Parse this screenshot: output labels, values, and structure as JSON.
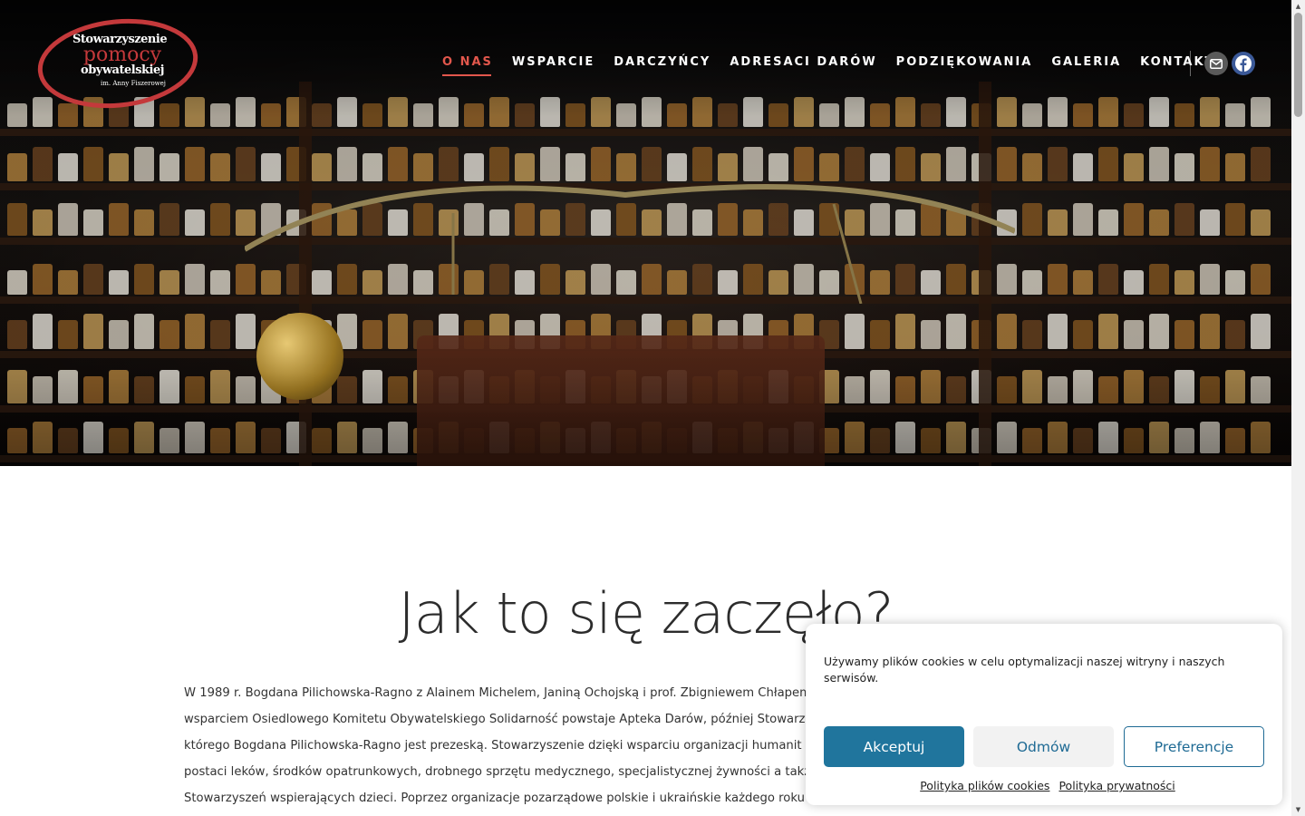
{
  "header": {
    "logo": {
      "line1": "Stowarzyszenie",
      "line2": "pomocy",
      "line3": "obywatelskiej",
      "line4": "im. Anny Fiszerowej"
    },
    "nav": [
      {
        "label": "O NAS",
        "active": true
      },
      {
        "label": "WSPARCIE",
        "active": false
      },
      {
        "label": "DARCZYŃCY",
        "active": false
      },
      {
        "label": "ADRESACI DARÓW",
        "active": false
      },
      {
        "label": "PODZIĘKOWANIA",
        "active": false
      },
      {
        "label": "GALERIA",
        "active": false
      },
      {
        "label": "KONTAKT",
        "active": false
      }
    ],
    "social": [
      {
        "icon": "envelope-icon"
      },
      {
        "icon": "facebook-icon"
      }
    ]
  },
  "main": {
    "heading": "Jak to się zaczęło?",
    "paragraph_lines": [
      "W 1989 r. Bogdana Pilichowska-Ragno z Alainem Michelem, Janiną Ochojską i prof. Zbigniewem Chłapem",
      "wsparciem Osiedlowego Komitetu Obywatelskiego Solidarność powstaje Apteka Darów, później Stowarzy",
      "którego Bogdana Pilichowska-Ragno jest prezeską.  Stowarzyszenie dzięki wsparciu organizacji humanit",
      "postaci leków, środków opatrunkowych, drobnego sprzętu medycznego, specjalistycznej żywności a także",
      "Stowarzyszeń wspierających dzieci. Poprzez organizacje pozarządowe polskie i ukraińskie każdego roku"
    ]
  },
  "cookie_banner": {
    "text": "Używamy plików cookies w celu optymalizacji naszej witryny i naszych serwisów.",
    "accept_label": "Akceptuj",
    "deny_label": "Odmów",
    "preferences_label": "Preferencje",
    "links": [
      "Polityka plików cookies",
      "Polityka prywatności"
    ]
  },
  "colors": {
    "accent": "#e2574c",
    "button_primary": "#20759d",
    "facebook": "#3b5998"
  }
}
